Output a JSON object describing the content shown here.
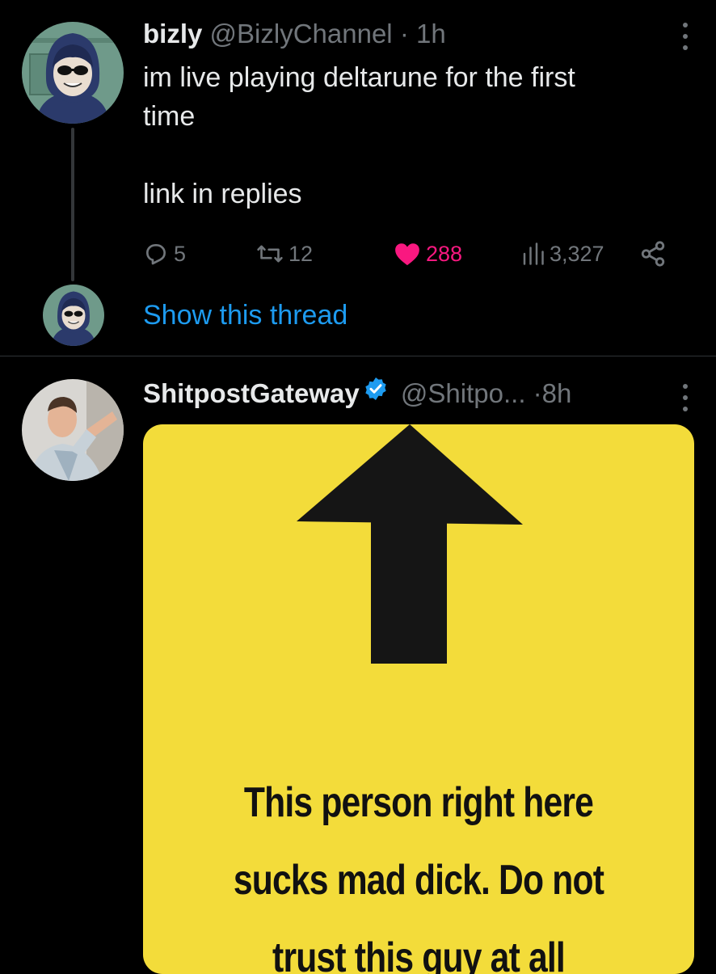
{
  "tweet1": {
    "name": "bizly",
    "handle": "@BizlyChannel",
    "separator": "·",
    "time": "1h",
    "text": "im live playing deltarune for the first\ntime\n\nlink in replies",
    "actions": {
      "replies": "5",
      "retweets": "12",
      "likes": "288",
      "views": "3,327"
    },
    "liked": true,
    "show_thread_label": "Show this thread"
  },
  "tweet2": {
    "name": "ShitpostGateway",
    "verified": true,
    "handle": "@Shitpo...",
    "separator": "·",
    "time": "8h",
    "media": {
      "caption": "This person right here\nsucks mad dick. Do not\ntrust this guy at all"
    }
  },
  "colors": {
    "background": "#000000",
    "text_primary": "#e7e9ea",
    "text_secondary": "#71767b",
    "like": "#f91880",
    "link": "#1d9bf0",
    "media_background": "#f3dc3a"
  },
  "icons": {
    "reply": "reply-icon",
    "retweet": "retweet-icon",
    "like": "heart-icon",
    "views": "views-icon",
    "share": "share-icon",
    "more": "more-icon",
    "verified": "verified-badge-icon",
    "arrow": "up-arrow-icon"
  }
}
